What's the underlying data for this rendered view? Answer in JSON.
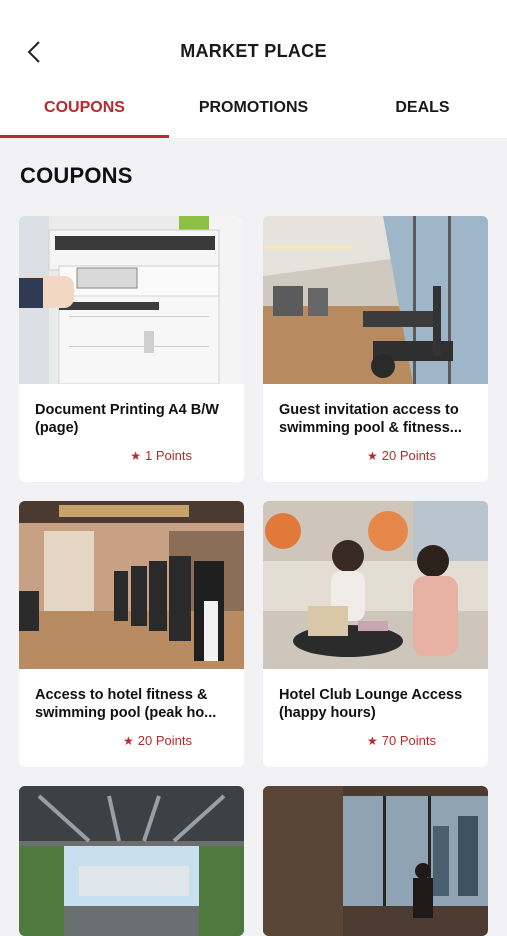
{
  "header": {
    "title": "MARKET PLACE",
    "back_icon": "chevron-left-icon"
  },
  "tabs": [
    {
      "label": "COUPONS",
      "active": true
    },
    {
      "label": "PROMOTIONS",
      "active": false
    },
    {
      "label": "DEALS",
      "active": false
    }
  ],
  "section_title": "COUPONS",
  "accent_color": "#b72a2e",
  "coupons": [
    {
      "name": "Document Printing A4 B/W (page)",
      "points": "1 Points"
    },
    {
      "name": "Guest invitation access to swimming pool & fitness...",
      "points": "20 Points"
    },
    {
      "name": "Access to hotel fitness & swimming pool (peak ho...",
      "points": "20 Points"
    },
    {
      "name": "Hotel Club Lounge Access (happy hours)",
      "points": "70 Points"
    },
    {
      "name": "",
      "points": ""
    },
    {
      "name": "",
      "points": ""
    }
  ]
}
